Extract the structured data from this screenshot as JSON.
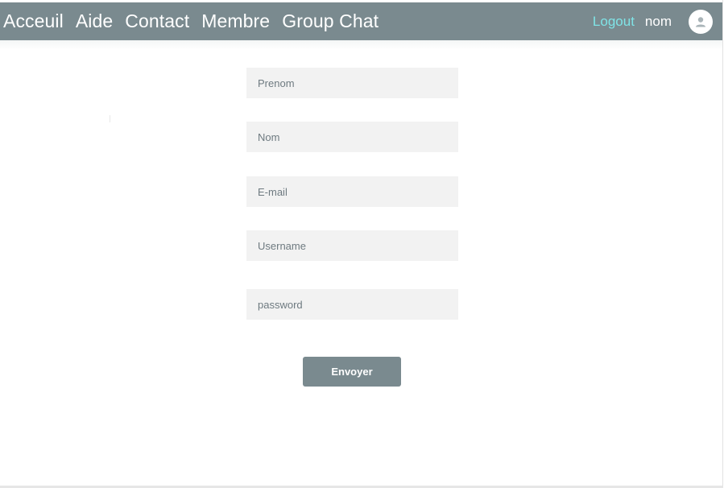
{
  "navbar": {
    "links": [
      "Acceuil",
      "Aide",
      "Contact",
      "Membre",
      "Group Chat"
    ],
    "logout_label": "Logout",
    "user_name": "nom",
    "avatar_icon": "user-avatar-icon"
  },
  "form": {
    "fields": [
      {
        "name": "prenom-field",
        "placeholder": "Prenom",
        "value": ""
      },
      {
        "name": "nom-field",
        "placeholder": "Nom",
        "value": ""
      },
      {
        "name": "email-field",
        "placeholder": "E-mail",
        "value": ""
      },
      {
        "name": "username-field",
        "placeholder": "Username",
        "value": ""
      },
      {
        "name": "password-field",
        "placeholder": "password",
        "value": ""
      }
    ],
    "submit_label": "Envoyer"
  },
  "colors": {
    "navbar_bg": "#7a8a8f",
    "logout": "#7fe3e6",
    "field_bg": "#f2f2f2",
    "button_bg": "#7a8a8f"
  }
}
